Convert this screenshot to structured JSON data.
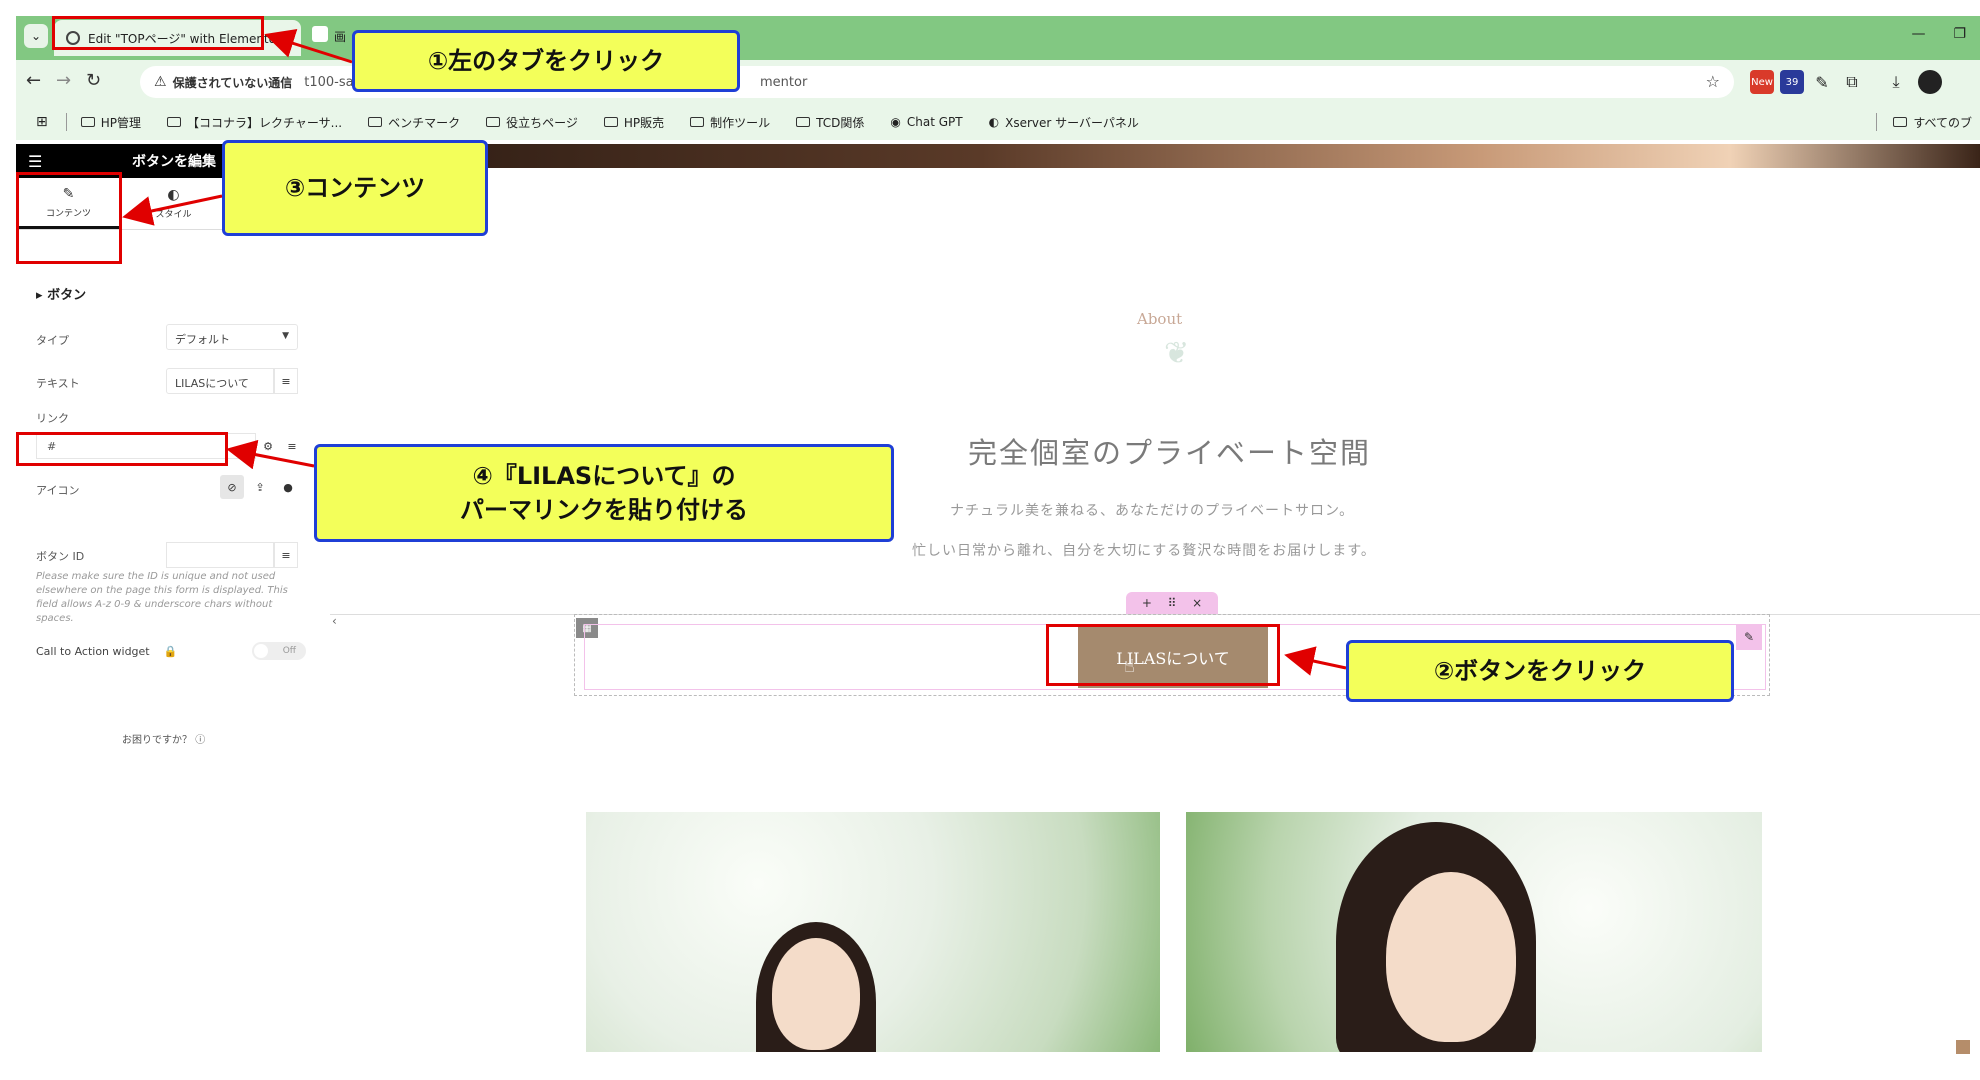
{
  "browser": {
    "active_tab_title": "Edit \"TOPページ\" with Elementor",
    "second_tab_title": "画",
    "security_label": "保護されていない通信",
    "url_start": "t100-sa",
    "url_end": "mentor",
    "ext_new_badge": "New",
    "ext_count_badge": "39",
    "window_minimize": "—",
    "window_restore": "❐",
    "bookmarks": [
      {
        "label": "HP管理",
        "type": "folder"
      },
      {
        "label": "【ココナラ】レクチャーサ...",
        "type": "folder"
      },
      {
        "label": "ベンチマーク",
        "type": "folder"
      },
      {
        "label": "役立ちページ",
        "type": "folder"
      },
      {
        "label": "HP販売",
        "type": "folder"
      },
      {
        "label": "制作ツール",
        "type": "folder"
      },
      {
        "label": "TCD関係",
        "type": "folder"
      },
      {
        "label": "Chat GPT",
        "type": "site"
      },
      {
        "label": "Xserver サーバーパネル",
        "type": "site"
      }
    ],
    "all_bookmarks": "すべてのブ"
  },
  "panel": {
    "title": "ボタンを編集",
    "tabs": [
      {
        "label": "コンテンツ",
        "icon": "pencil-icon"
      },
      {
        "label": "スタイル",
        "icon": "half-circle-icon"
      }
    ],
    "section_title": "ボタン",
    "type_label": "タイプ",
    "type_value": "デフォルト",
    "text_label": "テキスト",
    "text_value": "LILASについて",
    "link_label": "リンク",
    "link_value": "#",
    "icon_label": "アイコン",
    "button_id_label": "ボタン ID",
    "help_note": "Please make sure the ID is unique and not used elsewhere on the page this form is displayed. This field allows A-z 0-9 & underscore chars without spaces.",
    "cta_label": "Call to Action widget",
    "cta_toggle": "Off",
    "need_help": "お困りですか？"
  },
  "preview": {
    "about_label": "About",
    "heading": "完全個室のプライベート空間",
    "sub1": "ナチュラル美を兼ねる、あなただけのプライベートサロン。",
    "sub2": "忙しい日常から離れ、自分を大切にする贅沢な時間をお届けします。",
    "button_label": "LILASについて",
    "section_handle": [
      "+",
      "⠿",
      "×"
    ]
  },
  "annotations": {
    "step1": "①左のタブをクリック",
    "step2": "②ボタンをクリック",
    "step3": "③コンテンツ",
    "step4_line1": "④『LILASについて』の",
    "step4_line2": "パーマリンクを貼り付ける"
  },
  "colors": {
    "browser_green": "#82c882",
    "annotation_yellow": "#f3ff5a",
    "annotation_border": "#1f3fd6",
    "highlight_red": "#e00000",
    "button_brown": "#a58a6e",
    "editor_pink": "#f3c2ea"
  }
}
